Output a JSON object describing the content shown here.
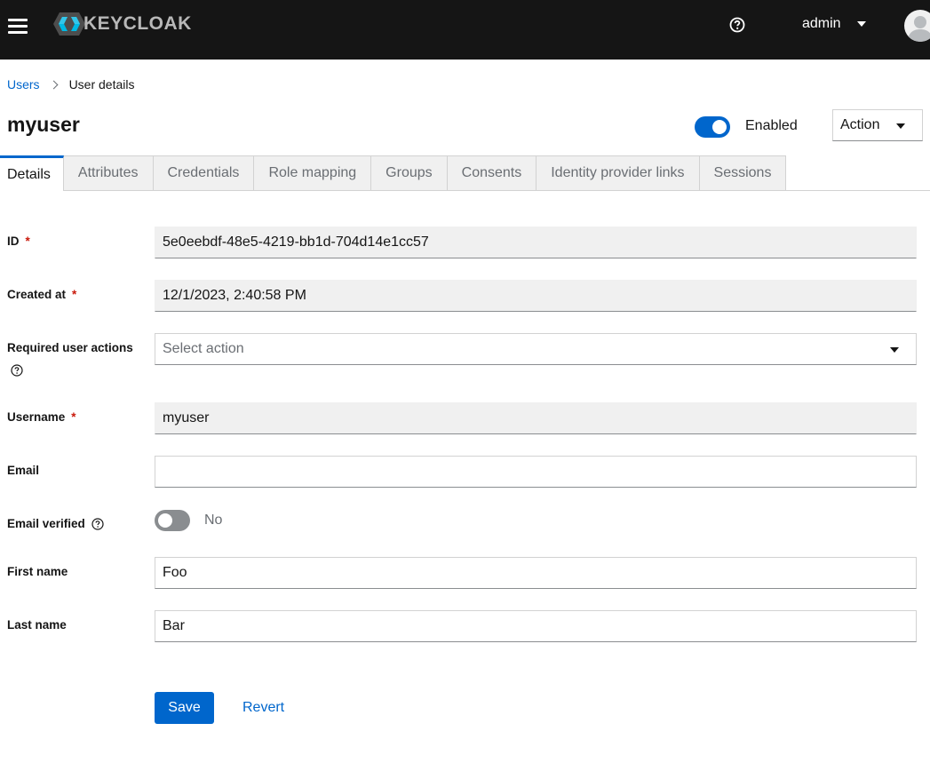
{
  "masthead": {
    "brand": "KEYCLOAK",
    "username": "admin",
    "menu_icon": "hamburger-icon",
    "help_icon": "help-circle-icon",
    "avatar_icon": "user-avatar-icon"
  },
  "breadcrumb": {
    "parent": "Users",
    "current": "User details"
  },
  "header": {
    "title": "myuser",
    "enabled_label": "Enabled",
    "enabled": true,
    "action_label": "Action"
  },
  "tabs": [
    {
      "label": "Details",
      "active": true
    },
    {
      "label": "Attributes",
      "active": false
    },
    {
      "label": "Credentials",
      "active": false
    },
    {
      "label": "Role mapping",
      "active": false
    },
    {
      "label": "Groups",
      "active": false
    },
    {
      "label": "Consents",
      "active": false
    },
    {
      "label": "Identity provider links",
      "active": false
    },
    {
      "label": "Sessions",
      "active": false
    }
  ],
  "form": {
    "id": {
      "label": "ID",
      "required_mark": "*",
      "value": "5e0eebdf-48e5-4219-bb1d-704d14e1cc57"
    },
    "created_at": {
      "label": "Created at",
      "required_mark": "*",
      "value": "12/1/2023, 2:40:58 PM"
    },
    "required_actions": {
      "label": "Required user actions",
      "placeholder": "Select action"
    },
    "username": {
      "label": "Username",
      "required_mark": "*",
      "value": "myuser"
    },
    "email": {
      "label": "Email",
      "value": ""
    },
    "email_verified": {
      "label": "Email verified",
      "value_label": "No",
      "checked": false
    },
    "first_name": {
      "label": "First name",
      "value": "Foo"
    },
    "last_name": {
      "label": "Last name",
      "value": "Bar"
    }
  },
  "buttons": {
    "save": "Save",
    "revert": "Revert"
  },
  "colors": {
    "masthead_bg": "#151515",
    "primary": "#0066cc",
    "required": "#c9190b",
    "readonly_bg": "#f0f0f0"
  }
}
